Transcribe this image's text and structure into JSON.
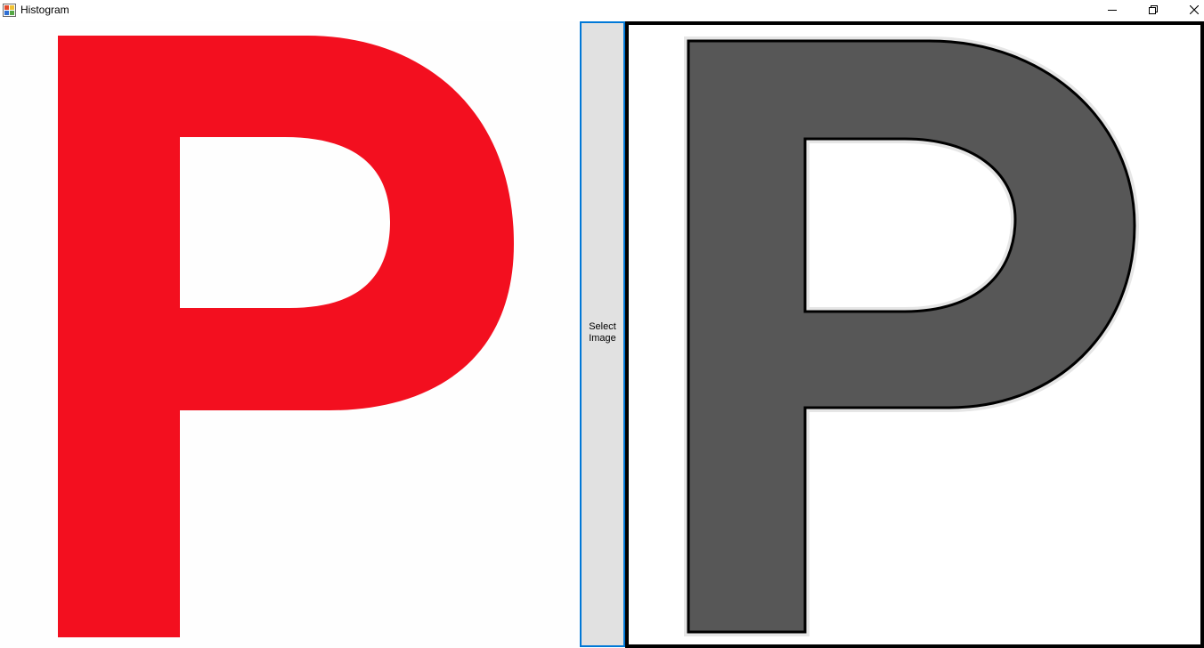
{
  "window": {
    "title": "Histogram",
    "app_icon": "winforms-app-icon",
    "controls": {
      "minimize_icon": "minimize-icon",
      "maximize_icon": "restore-icon",
      "close_icon": "close-icon"
    }
  },
  "left_image": {
    "content": "P",
    "color": "#f30f1f"
  },
  "select_button": {
    "label": "Select Image"
  },
  "right_image": {
    "content": "P",
    "fill_color": "#575757",
    "outline_color": "#000000"
  }
}
